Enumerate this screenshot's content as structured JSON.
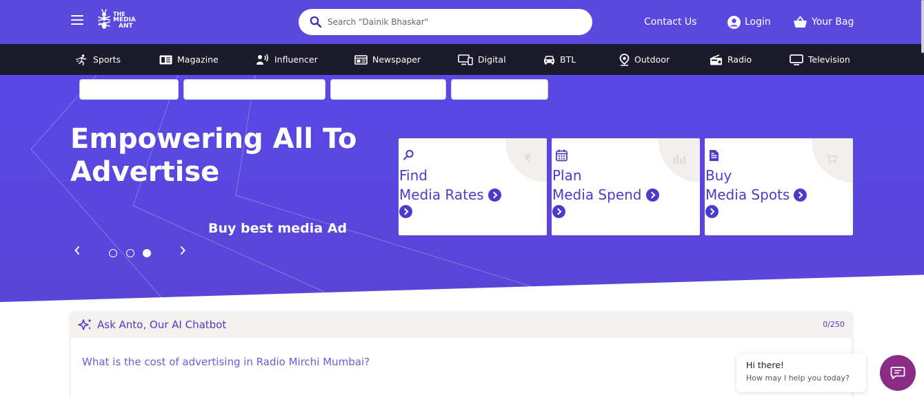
{
  "header": {
    "logo_text": [
      "THE",
      "MEDIA",
      "ANT"
    ],
    "search_placeholder": "Search \"Dainik Bhaskar\"",
    "contact_label": "Contact Us",
    "login_label": "Login",
    "bag_label": "Your Bag"
  },
  "categories": [
    {
      "label": "Sports",
      "icon": "runner-icon"
    },
    {
      "label": "Magazine",
      "icon": "magazine-icon"
    },
    {
      "label": "Influencer",
      "icon": "influencer-icon"
    },
    {
      "label": "Newspaper",
      "icon": "newspaper-icon"
    },
    {
      "label": "Digital",
      "icon": "digital-devices-icon"
    },
    {
      "label": "BTL",
      "icon": "car-icon"
    },
    {
      "label": "Outdoor",
      "icon": "location-pin-icon"
    },
    {
      "label": "Radio",
      "icon": "radio-icon"
    },
    {
      "label": "Television",
      "icon": "monitor-icon"
    }
  ],
  "hero": {
    "title": "Empowering All To Advertise",
    "subtitle": "Buy best media Ad",
    "slides_total": 3,
    "active_slide": 3
  },
  "cards": [
    {
      "line1": "Find",
      "line2": "Media Rates",
      "icon": "search-icon",
      "bg_symbol": "₹"
    },
    {
      "line1": "Plan",
      "line2": "Media Spend",
      "icon": "calendar-icon",
      "bg_symbol": "bar-chart"
    },
    {
      "line1": "Buy",
      "line2": "Media Spots",
      "icon": "document-icon",
      "bg_symbol": "cart"
    }
  ],
  "chatbot": {
    "title": "Ask Anto, Our AI Chatbot",
    "count": "0/250",
    "placeholder": "What is the cost of advertising in Radio Mirchi Mumbai?"
  },
  "help": {
    "title": "Hi there!",
    "subtitle": "How may I help you today?"
  },
  "colors": {
    "brand": "#5b48df",
    "nav_dark": "#1c1b2b",
    "accent": "#4b3bc9",
    "chat_fab": "#8a2b86"
  }
}
